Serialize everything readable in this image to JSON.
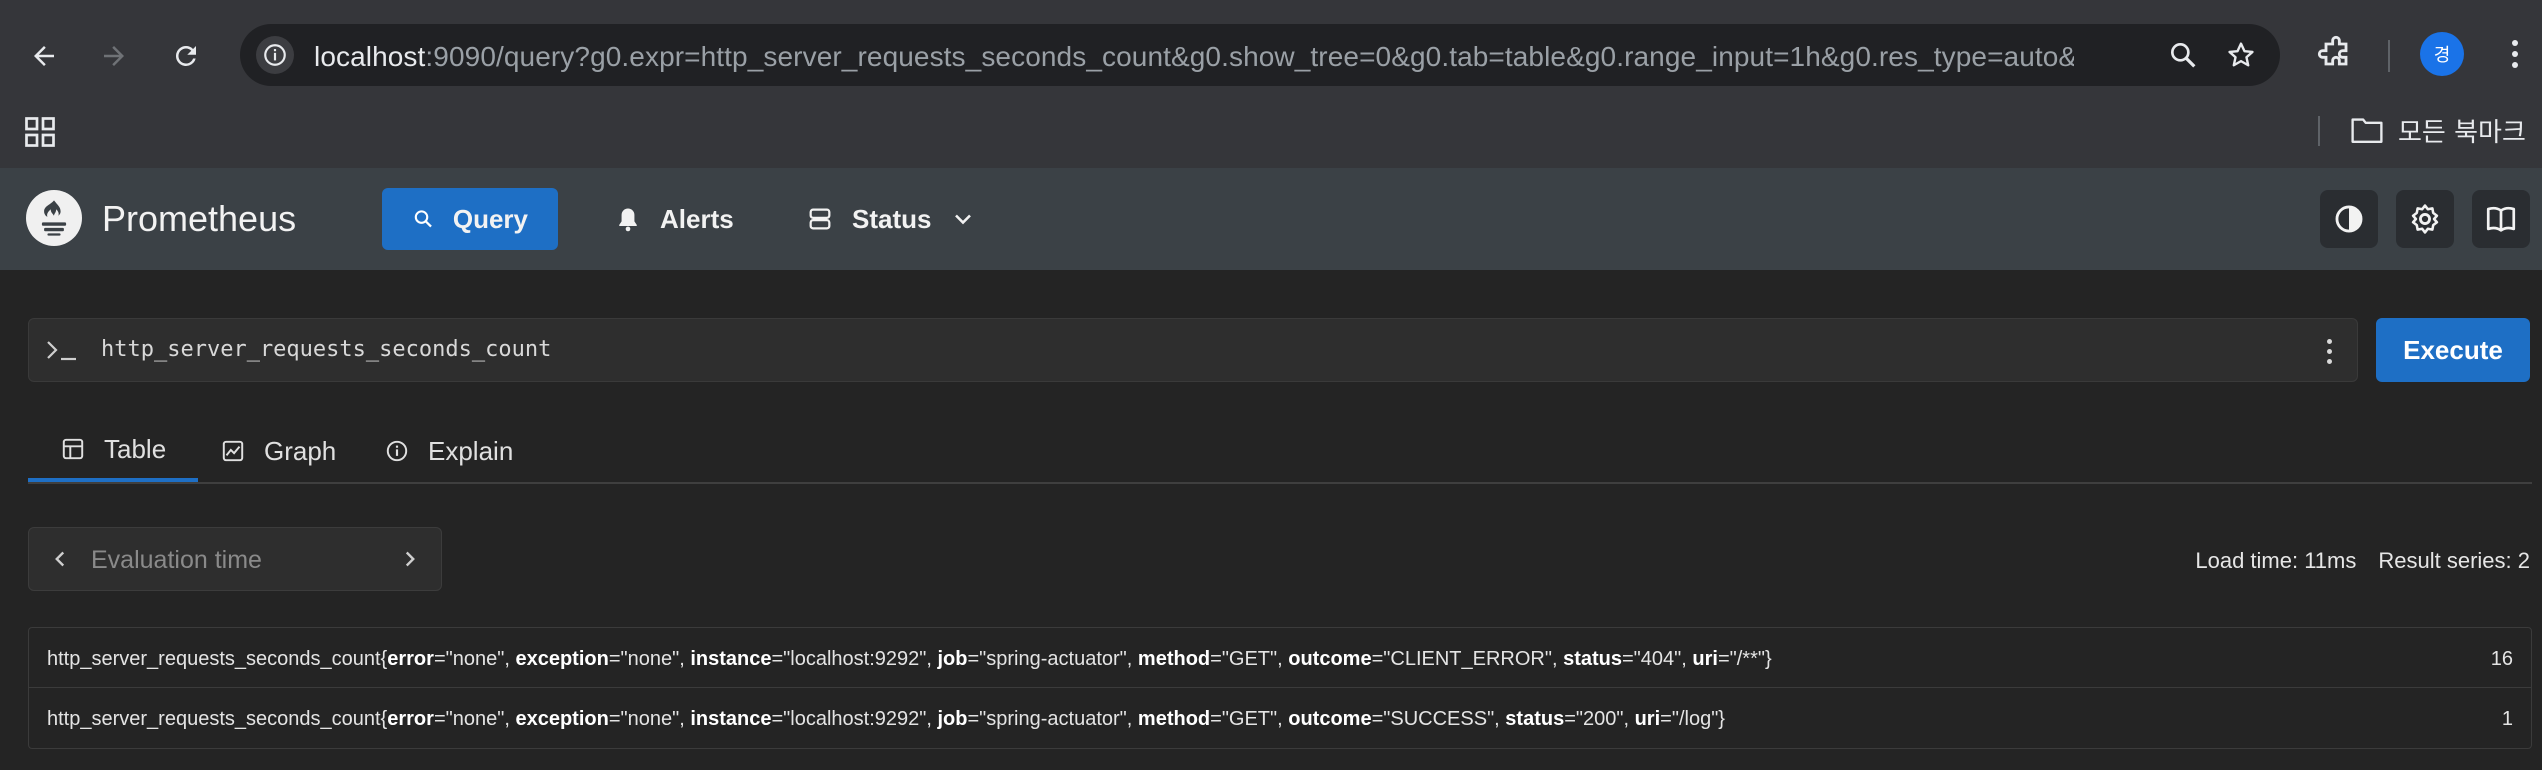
{
  "browser": {
    "url_host": "localhost",
    "url_rest": ":9090/query?g0.expr=http_server_requests_seconds_count&g0.show_tree=0&g0.tab=table&g0.range_input=1h&g0.res_type=auto&...",
    "profile_initial": "경",
    "bookmarks_all_label": "모든 북마크"
  },
  "header": {
    "brand": "Prometheus",
    "nav": {
      "query": "Query",
      "alerts": "Alerts",
      "status": "Status"
    }
  },
  "query": {
    "expression": "http_server_requests_seconds_count",
    "execute_label": "Execute"
  },
  "tabs": [
    {
      "label": "Table",
      "active": true
    },
    {
      "label": "Graph",
      "active": false
    },
    {
      "label": "Explain",
      "active": false
    }
  ],
  "evaluation": {
    "placeholder": "Evaluation time"
  },
  "stats": {
    "load_time": "Load time: 11ms",
    "result_series": "Result series: 2"
  },
  "results": [
    {
      "metric": "http_server_requests_seconds_count",
      "labels": [
        {
          "key": "error",
          "value": "\"none\""
        },
        {
          "key": "exception",
          "value": "\"none\""
        },
        {
          "key": "instance",
          "value": "\"localhost:9292\""
        },
        {
          "key": "job",
          "value": "\"spring-actuator\""
        },
        {
          "key": "method",
          "value": "\"GET\""
        },
        {
          "key": "outcome",
          "value": "\"CLIENT_ERROR\""
        },
        {
          "key": "status",
          "value": "\"404\""
        },
        {
          "key": "uri",
          "value": "\"/**\""
        }
      ],
      "value": "16"
    },
    {
      "metric": "http_server_requests_seconds_count",
      "labels": [
        {
          "key": "error",
          "value": "\"none\""
        },
        {
          "key": "exception",
          "value": "\"none\""
        },
        {
          "key": "instance",
          "value": "\"localhost:9292\""
        },
        {
          "key": "job",
          "value": "\"spring-actuator\""
        },
        {
          "key": "method",
          "value": "\"GET\""
        },
        {
          "key": "outcome",
          "value": "\"SUCCESS\""
        },
        {
          "key": "status",
          "value": "\"200\""
        },
        {
          "key": "uri",
          "value": "\"/log\""
        }
      ],
      "value": "1"
    }
  ],
  "colors": {
    "accent": "#1e6fc5",
    "header_bg": "#3b4146",
    "page_bg": "#242424"
  }
}
